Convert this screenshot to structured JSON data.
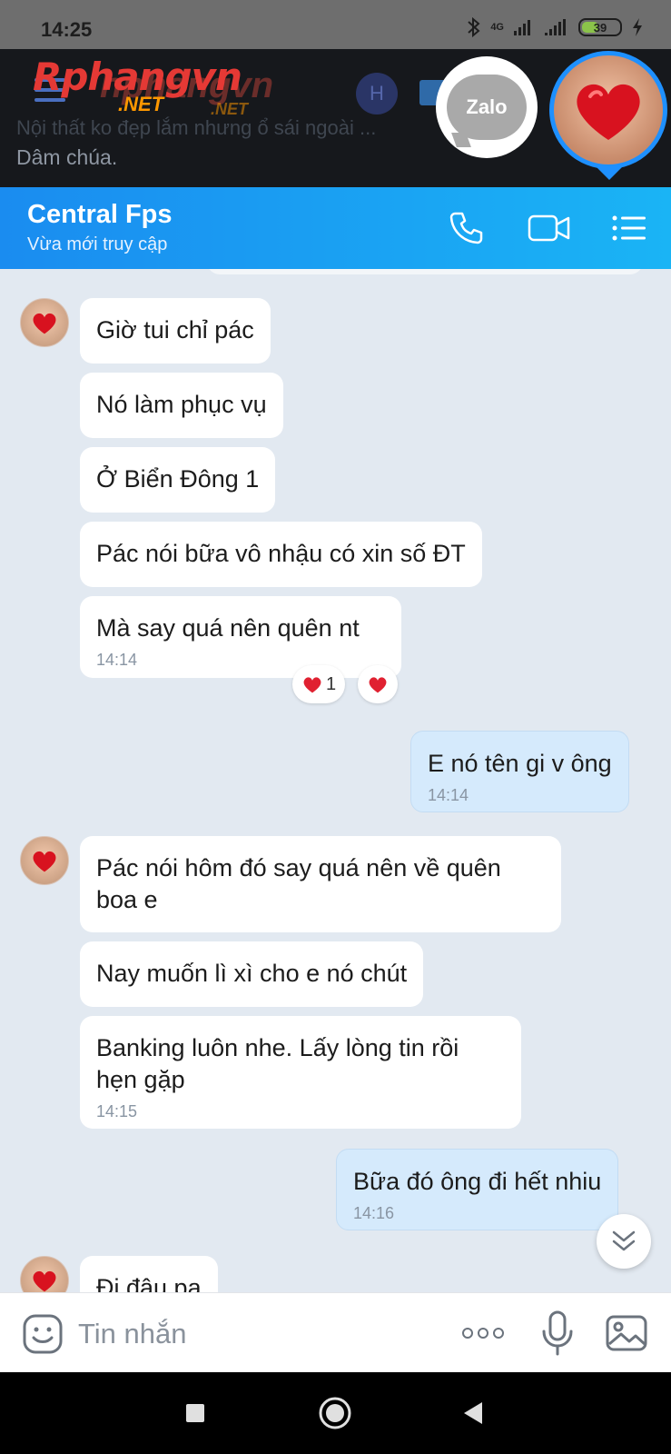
{
  "status_bar": {
    "time": "14:25",
    "network": "4G",
    "battery": "39"
  },
  "background_app": {
    "logo_main": "Rphangvn",
    "logo_net": ".NET",
    "logo_ghost": "hphangvn",
    "logo_ghost_net": ".NET",
    "avatar_letter": "H",
    "cut_line": "Nội thất ko đẹp lắm nhưng ổ sái ngoài ...",
    "text": "Dâm chúa."
  },
  "floating": {
    "zalo_label": "Zalo"
  },
  "header": {
    "contact_name": "Central Fps",
    "contact_status": "Vừa mới truy cập"
  },
  "messages": [
    {
      "text": "Giờ tui chỉ pác",
      "time": ""
    },
    {
      "text": "Nó làm phục vụ",
      "time": ""
    },
    {
      "text": "Ở Biển Đông 1",
      "time": ""
    },
    {
      "text": "Pác nói bữa vô nhậu có xin số ĐT",
      "time": ""
    },
    {
      "text": "Mà say quá nên quên nt",
      "time": "14:14"
    },
    {
      "text": "E nó tên gi v ông",
      "time": "14:14"
    },
    {
      "text": "Pác nói hôm đó say quá nên về quên boa e",
      "time": ""
    },
    {
      "text": "Nay muốn lì xì cho e nó chút",
      "time": ""
    },
    {
      "text": "Banking luôn nhe. Lấy lòng tin rồi hẹn gặp",
      "time": "14:15"
    },
    {
      "text": "Bữa đó ông đi hết nhiu",
      "time": "14:16"
    },
    {
      "text": "Đi đâu pa",
      "time": ""
    }
  ],
  "reactions": [
    {
      "count": "1"
    },
    {
      "count": ""
    }
  ],
  "input": {
    "placeholder": "Tin nhắn"
  },
  "colors": {
    "header_start": "#1a8cf0",
    "header_end": "#1ab4f5",
    "chat_bg": "#e2e9f1",
    "outgoing_bubble": "#d5eafc",
    "incoming_bubble": "#ffffff",
    "heart": "#e02131"
  }
}
